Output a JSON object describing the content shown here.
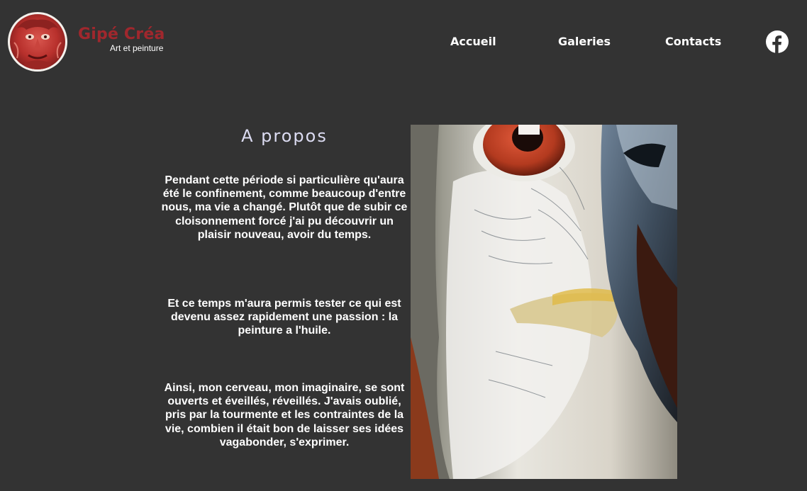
{
  "header": {
    "brand_title": "Gipé Créa",
    "brand_subtitle": "Art et peinture",
    "nav": [
      {
        "label": "Accueil"
      },
      {
        "label": "Galeries"
      },
      {
        "label": "Contacts"
      }
    ],
    "social_icon": "facebook-icon"
  },
  "about": {
    "title": "A propos",
    "paragraphs": [
      "Pendant cette période si particulière qu'aura été le confinement, comme beaucoup d'entre nous, ma vie a changé. Plutôt que de subir ce cloisonnement forcé j'ai pu découvrir un plaisir nouveau, avoir du temps.",
      "Et ce temps m'aura permis tester ce qui est devenu assez rapidement une passion : la peinture a l'huile.",
      "Ainsi, mon cerveau, mon imaginaire, se sont ouverts et éveillés, réveillés. J'avais oublié, pris par la tourmente et les contraintes de la vie, combien il était bon de laisser ses idées vagabonder, s'exprimer."
    ]
  },
  "colors": {
    "background": "#333333",
    "brand_red": "#b4262c",
    "text": "#ffffff",
    "title": "#dcdcf2"
  }
}
